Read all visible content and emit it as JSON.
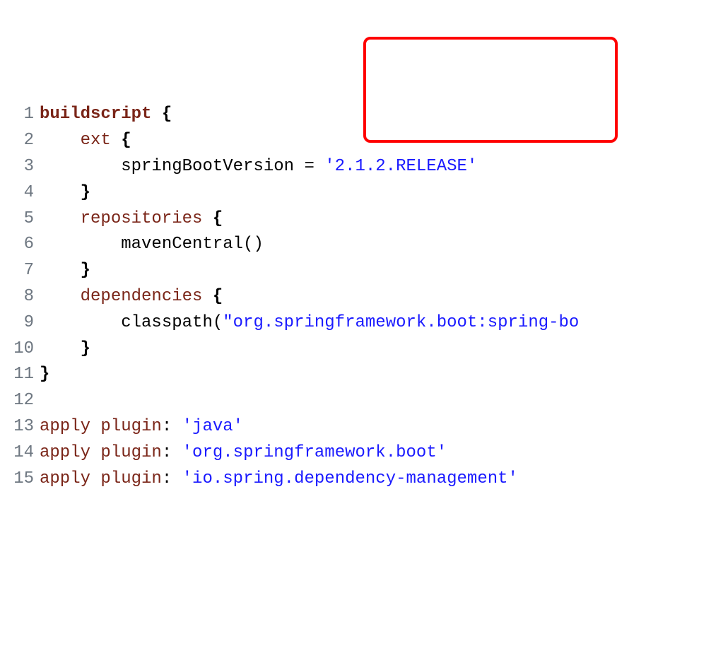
{
  "lines": {
    "l1": {
      "num": "1"
    },
    "l2": {
      "num": "2"
    },
    "l3": {
      "num": "3"
    },
    "l4": {
      "num": "4"
    },
    "l5": {
      "num": "5"
    },
    "l6": {
      "num": "6"
    },
    "l7": {
      "num": "7"
    },
    "l8": {
      "num": "8"
    },
    "l9": {
      "num": "9"
    },
    "l10": {
      "num": "10"
    },
    "l11": {
      "num": "11"
    },
    "l12": {
      "num": "12"
    },
    "l13": {
      "num": "13"
    },
    "l14": {
      "num": "14"
    },
    "l15": {
      "num": "15"
    }
  },
  "tokens": {
    "t1a": "buildscript",
    "t1b": " {",
    "t2a": "    ",
    "t2b": "ext",
    "t2c": " {",
    "t3a": "        springBootVersion = ",
    "t3b": "'2.1.2.RELEASE'",
    "t4a": "    }",
    "t5a": "    ",
    "t5b": "repositories",
    "t5c": " {",
    "t6a": "        mavenCentral()",
    "t7a": "    }",
    "t8a": "    ",
    "t8b": "dependencies",
    "t8c": " {",
    "t9a": "        classpath(",
    "t9b": "\"org.springframework.boot:spring-bo",
    "t10a": "    }",
    "t11a": "}",
    "t12a": "",
    "t13a": "apply",
    "t13b": " ",
    "t13c": "plugin",
    "t13d": ": ",
    "t13e": "'java'",
    "t14a": "apply",
    "t14b": " ",
    "t14c": "plugin",
    "t14d": ": ",
    "t14e": "'org.springframework.boot'",
    "t15a": "apply",
    "t15b": " ",
    "t15c": "plugin",
    "t15d": ": ",
    "t15e": "'io.spring.dependency-management'"
  },
  "highlight": {
    "top": "52",
    "left": "514",
    "width": "360",
    "height": "150"
  }
}
